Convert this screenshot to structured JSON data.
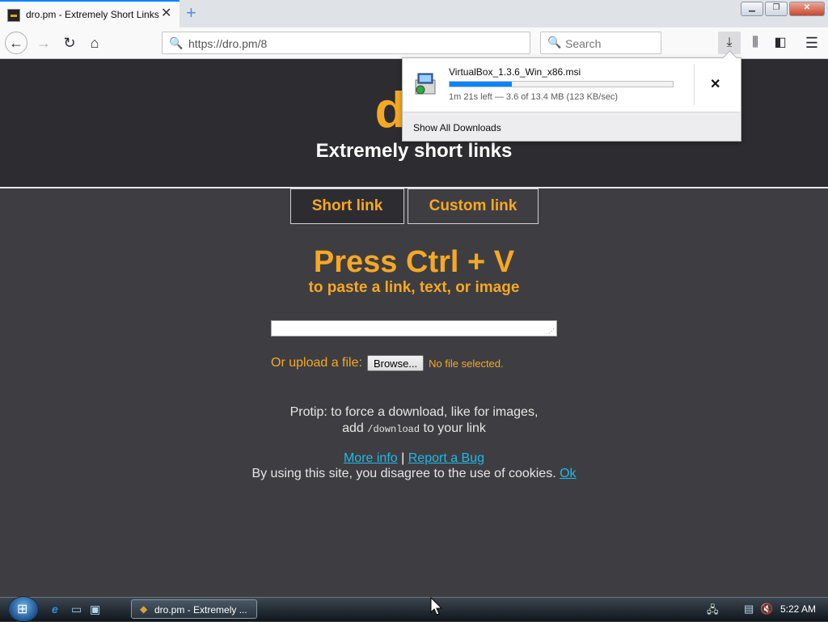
{
  "browser": {
    "tab_title": "dro.pm - Extremely Short Links",
    "new_tab_symbol": "+",
    "url": "https://dro.pm/8",
    "search_placeholder": "Search",
    "icons": {
      "back": "back-arrow-icon",
      "forward": "forward-arrow-icon",
      "reload": "reload-icon",
      "home": "home-icon",
      "downloads": "download-arrow-icon",
      "library": "library-icon",
      "sidebar": "sidebar-icon",
      "menu": "hamburger-menu-icon"
    }
  },
  "page": {
    "logo": "dro",
    "tagline": "Extremely short links",
    "tabs": [
      {
        "label": "Short link"
      },
      {
        "label": "Custom link"
      }
    ],
    "headline": "Press Ctrl + V",
    "subheadline": "to paste a link, text, or image",
    "upload_label": "Or upload a file:",
    "browse_label": "Browse...",
    "no_file": "No file selected.",
    "protip_line1": "Protip: to force a download, like for images,",
    "protip_add": "add",
    "protip_code": "/download",
    "protip_end": "to your link",
    "more_info": "More info",
    "separator": "|",
    "report_bug": "Report a Bug",
    "cookies_text": "By using this site, you disagree to the use of cookies.",
    "ok_link": "Ok",
    "colors": {
      "accent": "#f7a823",
      "background": "#3e3e42",
      "hero": "#2d2d31",
      "link": "#22b8e8"
    }
  },
  "downloads": {
    "file_name": "VirtualBox_1.3.6_Win_x86.msi",
    "progress_fraction": 0.28,
    "status": "1m 21s left — 3.6 of 13.4 MB (123 KB/sec)",
    "cancel_symbol": "✕",
    "show_all": "Show All Downloads"
  },
  "taskbar": {
    "task_label": "dro.pm - Extremely ...",
    "clock": "5:22 AM"
  }
}
